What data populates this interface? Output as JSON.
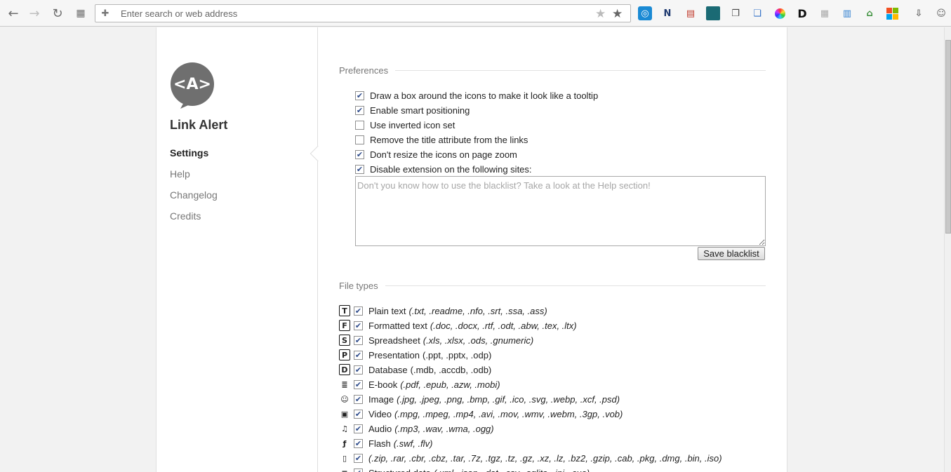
{
  "browser": {
    "back_icon": "back-arrow-icon",
    "forward_icon": "forward-arrow-icon",
    "reload_icon": "reload-icon",
    "apps_icon": "apps-grid-icon",
    "address_placeholder": "Enter search or web address",
    "extensions": [
      "ext-1",
      "ext-2",
      "ext-3",
      "ext-4",
      "ext-5",
      "ext-6",
      "ext-7",
      "ext-8",
      "ext-9",
      "ext-10",
      "ext-11",
      "ext-12",
      "ext-13",
      "ext-14",
      "ext-15"
    ]
  },
  "sidebar": {
    "logo_text": "<A>",
    "title": "Link Alert",
    "items": [
      {
        "label": "Settings",
        "active": true
      },
      {
        "label": "Help",
        "active": false
      },
      {
        "label": "Changelog",
        "active": false
      },
      {
        "label": "Credits",
        "active": false
      }
    ]
  },
  "preferences": {
    "heading": "Preferences",
    "options": [
      {
        "label": "Draw a box around the icons to make it look like a tooltip",
        "checked": true
      },
      {
        "label": "Enable smart positioning",
        "checked": true
      },
      {
        "label": "Use inverted icon set",
        "checked": false
      },
      {
        "label": "Remove the title attribute from the links",
        "checked": false
      },
      {
        "label": "Don't resize the icons on page zoom",
        "checked": true
      },
      {
        "label": "Disable extension on the following sites:",
        "checked": true
      }
    ],
    "blacklist_placeholder": "Don't you know how to use the blacklist? Take a look at the Help section!",
    "save_label": "Save blacklist"
  },
  "file_types": {
    "heading": "File types",
    "items": [
      {
        "icon": "T",
        "label": "Plain text",
        "extensions": "(.txt, .readme, .nfo, .srt, .ssa, .ass)",
        "checked": true
      },
      {
        "icon": "F",
        "label": "Formatted text",
        "extensions": "(.doc, .docx, .rtf, .odt, .abw, .tex, .ltx)",
        "checked": true
      },
      {
        "icon": "S",
        "label": "Spreadsheet",
        "extensions": "(.xls, .xlsx, .ods, .gnumeric)",
        "checked": true
      },
      {
        "icon": "P",
        "label": "Presentation",
        "extensions": "(.ppt, .pptx, .odp)",
        "checked": true
      },
      {
        "icon": "D",
        "label": "Database",
        "extensions": "(.mdb, .accdb, .odb)",
        "checked": true
      },
      {
        "icon": "≣",
        "label": "E-book",
        "extensions": "(.pdf, .epub, .azw, .mobi)",
        "checked": true
      },
      {
        "icon": "☺",
        "label": "Image",
        "extensions": "(.jpg, .jpeg, .png, .bmp, .gif, .ico, .svg, .webp, .xcf, .psd)",
        "checked": true
      },
      {
        "icon": "▣",
        "label": "Video",
        "extensions": "(.mpg, .mpeg, .mp4, .avi, .mov, .wmv, .webm, .3gp, .vob)",
        "checked": true
      },
      {
        "icon": "♫",
        "label": "Audio",
        "extensions": "(.mp3, .wav, .wma, .ogg)",
        "checked": true
      },
      {
        "icon": "ƒ",
        "label": "Flash",
        "extensions": "(.swf, .flv)",
        "checked": true
      },
      {
        "icon": "▯",
        "label": "",
        "extensions": "(.zip, .rar, .cbr, .cbz, .tar, .7z, .tgz, .tz, .gz, .xz, .lz, .bz2, .gzip, .cab, .pkg, .dmg, .bin, .iso)",
        "checked": true
      },
      {
        "icon": "≡",
        "label": "Structured data",
        "extensions": "(.xml, .json, .dat, .csv, .sqlite, .ini, .cue)",
        "checked": true
      }
    ]
  }
}
